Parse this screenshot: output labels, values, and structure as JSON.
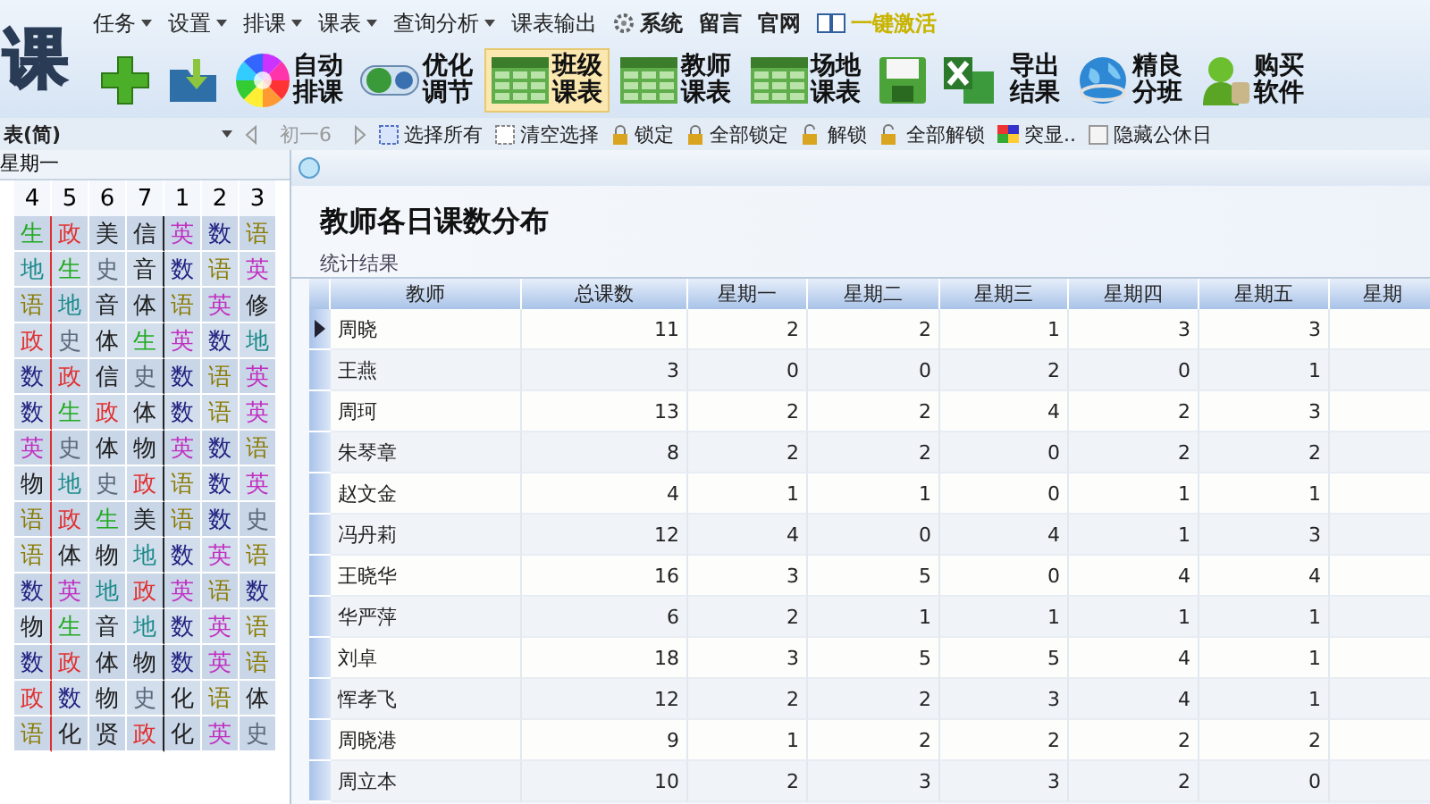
{
  "logo": "课",
  "menu": [
    {
      "label": "任务",
      "dropdown": true
    },
    {
      "label": "设置",
      "dropdown": true
    },
    {
      "label": "排课",
      "dropdown": true
    },
    {
      "label": "课表",
      "dropdown": true
    },
    {
      "label": "查询分析",
      "dropdown": true
    },
    {
      "label": "课表输出",
      "dropdown": false
    }
  ],
  "menu_links": [
    {
      "label": "系统",
      "kind": "gear"
    },
    {
      "label": "留言",
      "kind": "plain"
    },
    {
      "label": "官网",
      "kind": "plain"
    },
    {
      "label": "一键激活",
      "kind": "book"
    }
  ],
  "toolbar": [
    {
      "kind": "plus",
      "selected": false
    },
    {
      "kind": "folder",
      "selected": false
    },
    {
      "kind": "wheel",
      "label": "自动排课",
      "selected": false
    },
    {
      "kind": "toggle",
      "label": "优化调节",
      "selected": false
    },
    {
      "kind": "grid",
      "label": "班级课表",
      "selected": true
    },
    {
      "kind": "grid",
      "label": "教师课表",
      "selected": false
    },
    {
      "kind": "grid",
      "label": "场地课表",
      "selected": false
    },
    {
      "kind": "floppy",
      "selected": false
    },
    {
      "kind": "excel",
      "selected": false
    },
    {
      "kind": "text",
      "label": "导出结果",
      "selected": false
    },
    {
      "kind": "globe",
      "label": "精良分班",
      "selected": false
    },
    {
      "kind": "person",
      "label": "购买软件",
      "selected": false
    }
  ],
  "subbar": [
    {
      "kind": "dropdown",
      "label": "表(简)"
    },
    {
      "kind": "prev"
    },
    {
      "kind": "text",
      "label": "初一6"
    },
    {
      "kind": "next"
    },
    {
      "kind": "select",
      "label": "选择所有"
    },
    {
      "kind": "clear",
      "label": "清空选择"
    },
    {
      "kind": "lock",
      "label": "锁定"
    },
    {
      "kind": "lock",
      "label": "全部锁定"
    },
    {
      "kind": "unlock",
      "label": "解锁"
    },
    {
      "kind": "unlock",
      "label": "全部解锁"
    },
    {
      "kind": "palette",
      "label": "突显.."
    },
    {
      "kind": "checkbox",
      "label": "隐藏公休日",
      "checked": false
    }
  ],
  "timetable": {
    "day": "星期一",
    "periods": [
      "4",
      "5",
      "6",
      "7",
      "1",
      "2",
      "3"
    ],
    "rows": [
      [
        {
          "text": "生",
          "color": "#22aa22"
        },
        {
          "text": "政",
          "color": "#e03030"
        },
        {
          "text": "美",
          "color": "#202020"
        },
        {
          "text": "信",
          "color": "#202020"
        },
        {
          "text": "英",
          "color": "#c030c0"
        },
        {
          "text": "数",
          "color": "#202080"
        },
        {
          "text": "语",
          "color": "#8a7a00"
        }
      ],
      [
        {
          "text": "地",
          "color": "#1a8a8a"
        },
        {
          "text": "生",
          "color": "#22aa22"
        },
        {
          "text": "史",
          "color": "#5a6a7c"
        },
        {
          "text": "音",
          "color": "#202020"
        },
        {
          "text": "数",
          "color": "#202080"
        },
        {
          "text": "语",
          "color": "#8a7a00"
        },
        {
          "text": "英",
          "color": "#c030c0"
        }
      ],
      [
        {
          "text": "语",
          "color": "#8a7a00"
        },
        {
          "text": "地",
          "color": "#1a8a8a"
        },
        {
          "text": "音",
          "color": "#202020"
        },
        {
          "text": "体",
          "color": "#202020"
        },
        {
          "text": "语",
          "color": "#8a7a00"
        },
        {
          "text": "英",
          "color": "#c030c0"
        },
        {
          "text": "修",
          "color": "#202020"
        }
      ],
      [
        {
          "text": "政",
          "color": "#e03030"
        },
        {
          "text": "史",
          "color": "#5a6a7c"
        },
        {
          "text": "体",
          "color": "#202020"
        },
        {
          "text": "生",
          "color": "#22aa22"
        },
        {
          "text": "英",
          "color": "#c030c0"
        },
        {
          "text": "数",
          "color": "#202080"
        },
        {
          "text": "地",
          "color": "#1a8a8a"
        }
      ],
      [
        {
          "text": "数",
          "color": "#202080"
        },
        {
          "text": "政",
          "color": "#e03030"
        },
        {
          "text": "信",
          "color": "#202020"
        },
        {
          "text": "史",
          "color": "#5a6a7c"
        },
        {
          "text": "数",
          "color": "#202080"
        },
        {
          "text": "语",
          "color": "#8a7a00"
        },
        {
          "text": "英",
          "color": "#c030c0"
        }
      ],
      [
        {
          "text": "数",
          "color": "#202080"
        },
        {
          "text": "生",
          "color": "#22aa22"
        },
        {
          "text": "政",
          "color": "#e03030"
        },
        {
          "text": "体",
          "color": "#202020"
        },
        {
          "text": "数",
          "color": "#202080"
        },
        {
          "text": "语",
          "color": "#8a7a00"
        },
        {
          "text": "英",
          "color": "#c030c0"
        }
      ],
      [
        {
          "text": "英",
          "color": "#c030c0"
        },
        {
          "text": "史",
          "color": "#5a6a7c"
        },
        {
          "text": "体",
          "color": "#202020"
        },
        {
          "text": "物",
          "color": "#202020"
        },
        {
          "text": "英",
          "color": "#c030c0"
        },
        {
          "text": "数",
          "color": "#202080"
        },
        {
          "text": "语",
          "color": "#8a7a00"
        }
      ],
      [
        {
          "text": "物",
          "color": "#202020"
        },
        {
          "text": "地",
          "color": "#1a8a8a"
        },
        {
          "text": "史",
          "color": "#5a6a7c"
        },
        {
          "text": "政",
          "color": "#e03030"
        },
        {
          "text": "语",
          "color": "#8a7a00"
        },
        {
          "text": "数",
          "color": "#202080"
        },
        {
          "text": "英",
          "color": "#c030c0"
        }
      ],
      [
        {
          "text": "语",
          "color": "#8a7a00"
        },
        {
          "text": "政",
          "color": "#e03030"
        },
        {
          "text": "生",
          "color": "#22aa22"
        },
        {
          "text": "美",
          "color": "#202020"
        },
        {
          "text": "语",
          "color": "#8a7a00"
        },
        {
          "text": "数",
          "color": "#202080"
        },
        {
          "text": "史",
          "color": "#5a6a7c"
        }
      ],
      [
        {
          "text": "语",
          "color": "#8a7a00"
        },
        {
          "text": "体",
          "color": "#202020"
        },
        {
          "text": "物",
          "color": "#202020"
        },
        {
          "text": "地",
          "color": "#1a8a8a"
        },
        {
          "text": "数",
          "color": "#202080"
        },
        {
          "text": "英",
          "color": "#c030c0"
        },
        {
          "text": "语",
          "color": "#8a7a00"
        }
      ],
      [
        {
          "text": "数",
          "color": "#202080"
        },
        {
          "text": "英",
          "color": "#c030c0"
        },
        {
          "text": "地",
          "color": "#1a8a8a"
        },
        {
          "text": "政",
          "color": "#e03030"
        },
        {
          "text": "英",
          "color": "#c030c0"
        },
        {
          "text": "语",
          "color": "#8a7a00"
        },
        {
          "text": "数",
          "color": "#202080"
        }
      ],
      [
        {
          "text": "物",
          "color": "#202020"
        },
        {
          "text": "生",
          "color": "#22aa22"
        },
        {
          "text": "音",
          "color": "#202020"
        },
        {
          "text": "地",
          "color": "#1a8a8a"
        },
        {
          "text": "数",
          "color": "#202080"
        },
        {
          "text": "英",
          "color": "#c030c0"
        },
        {
          "text": "语",
          "color": "#8a7a00"
        }
      ],
      [
        {
          "text": "数",
          "color": "#202080"
        },
        {
          "text": "政",
          "color": "#e03030"
        },
        {
          "text": "体",
          "color": "#202020"
        },
        {
          "text": "物",
          "color": "#202020"
        },
        {
          "text": "数",
          "color": "#202080"
        },
        {
          "text": "英",
          "color": "#c030c0"
        },
        {
          "text": "语",
          "color": "#8a7a00"
        }
      ],
      [
        {
          "text": "政",
          "color": "#e03030"
        },
        {
          "text": "数",
          "color": "#202080"
        },
        {
          "text": "物",
          "color": "#202020"
        },
        {
          "text": "史",
          "color": "#5a6a7c"
        },
        {
          "text": "化",
          "color": "#202020"
        },
        {
          "text": "语",
          "color": "#8a7a00"
        },
        {
          "text": "体",
          "color": "#202020"
        }
      ],
      [
        {
          "text": "语",
          "color": "#8a7a00"
        },
        {
          "text": "化",
          "color": "#202020"
        },
        {
          "text": "贤",
          "color": "#202020"
        },
        {
          "text": "政",
          "color": "#e03030"
        },
        {
          "text": "化",
          "color": "#202020"
        },
        {
          "text": "英",
          "color": "#c030c0"
        },
        {
          "text": "史",
          "color": "#5a6a7c"
        }
      ]
    ]
  },
  "dialog": {
    "title": "教师各日课数分布",
    "section": "统计结果",
    "columns": [
      "教师",
      "总课数",
      "星期一",
      "星期二",
      "星期三",
      "星期四",
      "星期五",
      "星期"
    ],
    "rows": [
      {
        "selected": true,
        "cells": [
          "周晓",
          "11",
          "2",
          "2",
          "1",
          "3",
          "3"
        ]
      },
      {
        "selected": false,
        "cells": [
          "王燕",
          "3",
          "0",
          "0",
          "2",
          "0",
          "1"
        ]
      },
      {
        "selected": false,
        "cells": [
          "周珂",
          "13",
          "2",
          "2",
          "4",
          "2",
          "3"
        ]
      },
      {
        "selected": false,
        "cells": [
          "朱琴章",
          "8",
          "2",
          "2",
          "0",
          "2",
          "2"
        ]
      },
      {
        "selected": false,
        "cells": [
          "赵文金",
          "4",
          "1",
          "1",
          "0",
          "1",
          "1"
        ]
      },
      {
        "selected": false,
        "cells": [
          "冯丹莉",
          "12",
          "4",
          "0",
          "4",
          "1",
          "3"
        ]
      },
      {
        "selected": false,
        "cells": [
          "王晓华",
          "16",
          "3",
          "5",
          "0",
          "4",
          "4"
        ]
      },
      {
        "selected": false,
        "cells": [
          "华严萍",
          "6",
          "2",
          "1",
          "1",
          "1",
          "1"
        ]
      },
      {
        "selected": false,
        "cells": [
          "刘卓",
          "18",
          "3",
          "5",
          "5",
          "4",
          "1"
        ]
      },
      {
        "selected": false,
        "cells": [
          "恽孝飞",
          "12",
          "2",
          "2",
          "3",
          "4",
          "1"
        ]
      },
      {
        "selected": false,
        "cells": [
          "周晓港",
          "9",
          "1",
          "2",
          "2",
          "2",
          "2"
        ]
      },
      {
        "selected": false,
        "cells": [
          "周立本",
          "10",
          "2",
          "3",
          "3",
          "2",
          "0"
        ]
      }
    ]
  }
}
